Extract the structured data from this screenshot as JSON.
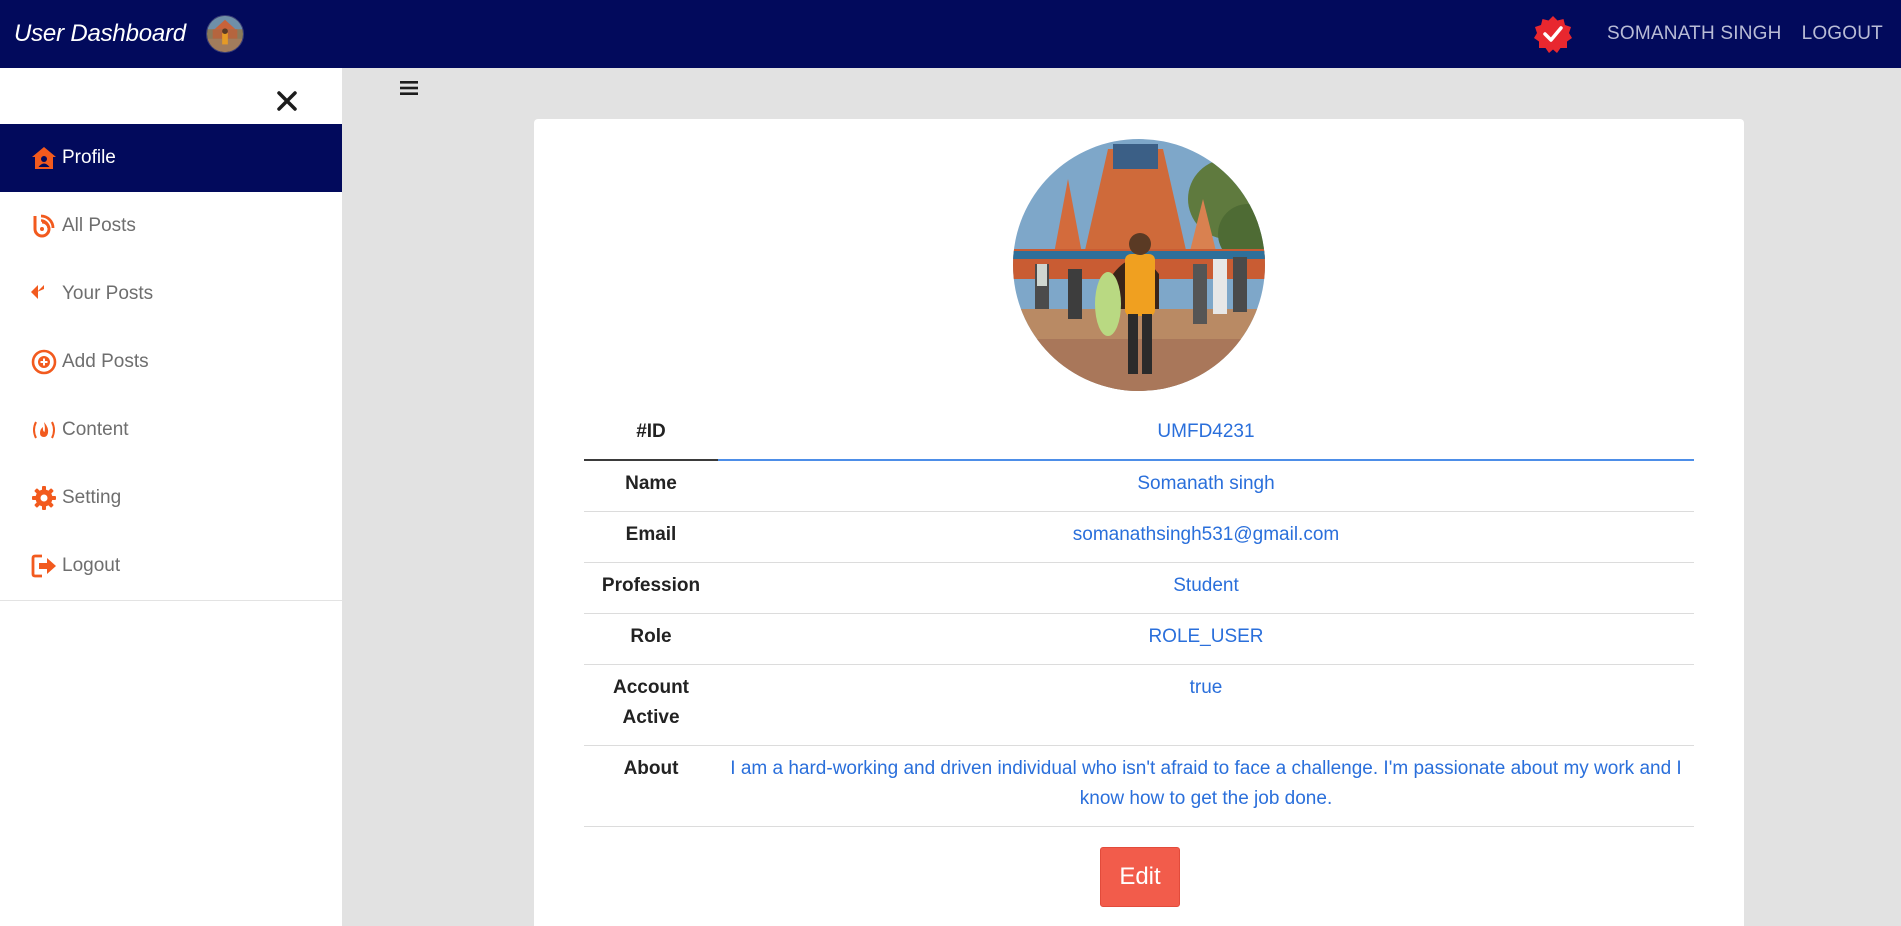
{
  "header": {
    "title": "User Dashboard",
    "avatar_icon": "user-avatar",
    "verified_icon": "verified-badge-icon",
    "username": "SOMANATH SINGH",
    "logout": "LOGOUT",
    "bg_color": "#020a5c"
  },
  "sidebar": {
    "close_icon": "close-icon",
    "items": [
      {
        "label": "Profile",
        "icon": "home-user-icon",
        "active": true
      },
      {
        "label": "All Posts",
        "icon": "blog-icon"
      },
      {
        "label": "Your Posts",
        "icon": "reply-all-icon"
      },
      {
        "label": "Add Posts",
        "icon": "add-circle-icon"
      },
      {
        "label": "Content",
        "icon": "fire-icon"
      },
      {
        "label": "Setting",
        "icon": "gear-icon"
      },
      {
        "label": "Logout",
        "icon": "sign-out-icon"
      }
    ],
    "accent_color": "#f25a1e"
  },
  "main": {
    "menu_icon": "hamburger-icon",
    "profile": {
      "rows": [
        {
          "label": "#ID",
          "value": "UMFD4231"
        },
        {
          "label": "Name",
          "value": "Somanath singh"
        },
        {
          "label": "Email",
          "value": "somanathsingh531@gmail.com"
        },
        {
          "label": "Profession",
          "value": "Student"
        },
        {
          "label": "Role",
          "value": "ROLE_USER"
        },
        {
          "label": "Account Active",
          "value": "true"
        },
        {
          "label": "About",
          "value": "I am a hard-working and driven individual who isn't afraid to face a challenge. I'm passionate about my work and I know how to get the job done."
        }
      ],
      "value_color": "#2a6fdb"
    },
    "edit_button": "Edit",
    "edit_color": "#f25c4b"
  }
}
